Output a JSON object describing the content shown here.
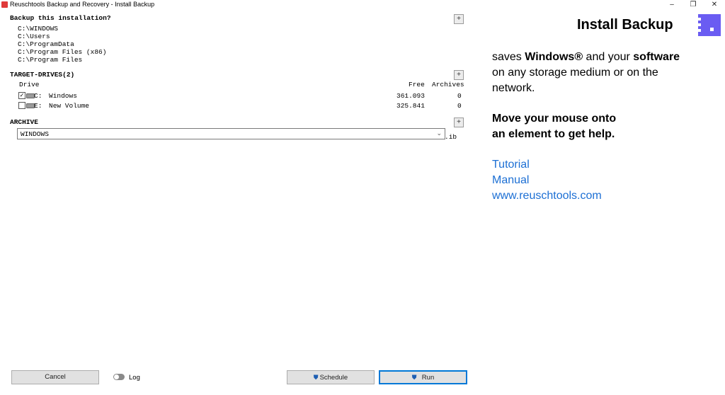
{
  "window": {
    "title": "Reuschtools Backup and Recovery - Install Backup",
    "minimize": "–",
    "maximize": "❐",
    "close": "✕"
  },
  "backup_section": {
    "title": "Backup this installation?",
    "plus": "+",
    "paths": [
      "C:\\WINDOWS",
      "C:\\Users",
      "C:\\ProgramData",
      "C:\\Program Files (x86)",
      "C:\\Program Files"
    ]
  },
  "target_section": {
    "title": "TARGET-DRIVES(2)",
    "plus": "+",
    "columns": {
      "drive": "Drive",
      "free": "Free",
      "archives": "Archives"
    },
    "drives": [
      {
        "letter": "C:",
        "name": "Windows",
        "free": "361.093",
        "archives": "0",
        "checked": true,
        "check_mark": "✓"
      },
      {
        "letter": "E:",
        "name": "New Volume",
        "free": "325.841",
        "archives": "0",
        "checked": false,
        "check_mark": ""
      }
    ]
  },
  "archive_section": {
    "title": "ARCHIVE",
    "plus": "+",
    "value": "WINDOWS",
    "extension": ".ib",
    "arrow": "⌄"
  },
  "footer": {
    "cancel": "Cancel",
    "log": "Log",
    "schedule": "Schedule",
    "run": "Run",
    "shield_icon": "⛊"
  },
  "help": {
    "heading": "Install Backup",
    "lead_pre": "saves ",
    "lead_b1": "Windows®",
    "lead_mid": " and your ",
    "lead_b2": "software",
    "lead_line2": "on any storage medium or on the",
    "lead_line3": "network.",
    "mouse_line1": "Move your mouse onto",
    "mouse_line2": "an element to get help.",
    "links": [
      "Tutorial",
      "Manual",
      "www.reuschtools.com"
    ]
  },
  "colors": {
    "accent": "#6a5cf2",
    "link": "#1c6fd4",
    "run_border": "#0078d7"
  }
}
